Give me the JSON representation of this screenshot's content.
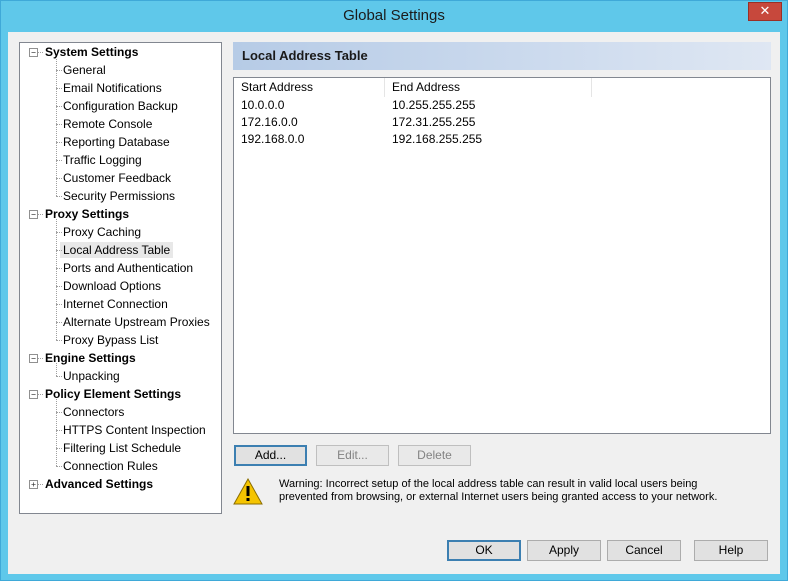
{
  "window": {
    "title": "Global Settings",
    "close_glyph": "✕"
  },
  "tree": {
    "groups": [
      {
        "label": "System Settings",
        "expanded": true,
        "items": [
          "General",
          "Email Notifications",
          "Configuration Backup",
          "Remote Console",
          "Reporting Database",
          "Traffic Logging",
          "Customer Feedback",
          "Security Permissions"
        ]
      },
      {
        "label": "Proxy Settings",
        "expanded": true,
        "items": [
          "Proxy Caching",
          "Local Address Table",
          "Ports and Authentication",
          "Download Options",
          "Internet Connection",
          "Alternate Upstream Proxies",
          "Proxy Bypass List"
        ]
      },
      {
        "label": "Engine Settings",
        "expanded": true,
        "items": [
          "Unpacking"
        ]
      },
      {
        "label": "Policy Element Settings",
        "expanded": true,
        "items": [
          "Connectors",
          "HTTPS Content Inspection",
          "Filtering List Schedule",
          "Connection Rules"
        ]
      },
      {
        "label": "Advanced Settings",
        "expanded": false,
        "items": []
      }
    ],
    "selected": "Local Address Table"
  },
  "panel": {
    "title": "Local Address Table",
    "columns": [
      "Start Address",
      "End Address"
    ],
    "rows": [
      [
        "10.0.0.0",
        "10.255.255.255"
      ],
      [
        "172.16.0.0",
        "172.31.255.255"
      ],
      [
        "192.168.0.0",
        "192.168.255.255"
      ]
    ],
    "buttons": {
      "add": "Add...",
      "edit": "Edit...",
      "delete": "Delete"
    },
    "warning": {
      "line1": "Warning: Incorrect setup of the local address table can result in valid local users being",
      "line2": "prevented from browsing, or external Internet users being granted access to your network."
    }
  },
  "footer": {
    "ok": "OK",
    "apply": "Apply",
    "cancel": "Cancel",
    "help": "Help"
  },
  "colors": {
    "title_bar": "#5fc8ea",
    "close_button": "#c7483c",
    "default_button_border": "#3c7fb1",
    "warning_yellow": "#f5c400"
  }
}
